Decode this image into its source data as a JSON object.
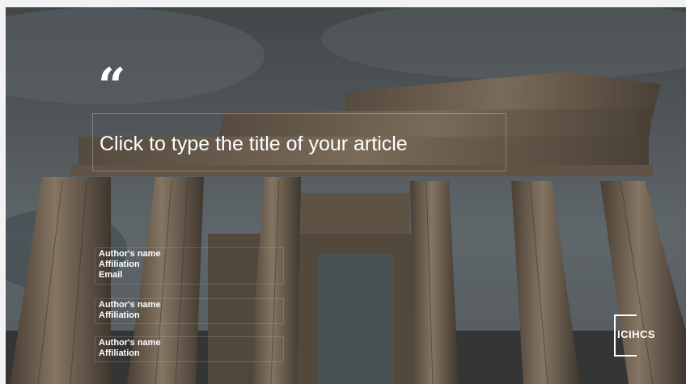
{
  "slide": {
    "quote_glyph": "“",
    "title_placeholder": "Click to type the title of your article",
    "authors": [
      {
        "name": "Author's name",
        "affiliation": "Affiliation",
        "email": "Email"
      },
      {
        "name": "Author's name",
        "affiliation": "Affiliation"
      },
      {
        "name": "Author's name",
        "affiliation": "Affiliation"
      }
    ],
    "logo_text": "ICIHCS"
  },
  "colors": {
    "text": "#ffffff",
    "sky": "#6a7276",
    "stone": "#8a7a66"
  },
  "icons": [
    "quote-icon",
    "logo-icon"
  ]
}
